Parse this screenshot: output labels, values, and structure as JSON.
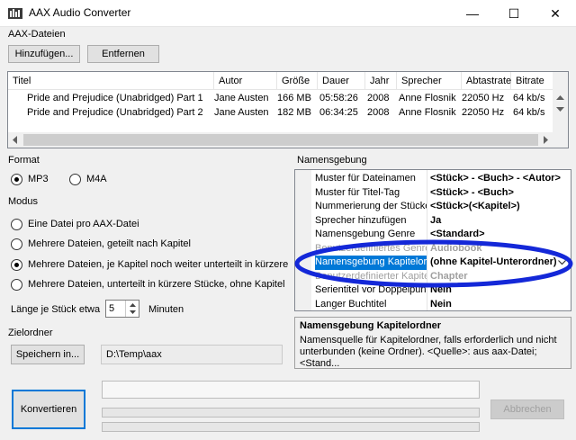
{
  "window": {
    "title": "AAX Audio Converter",
    "minimize": "—",
    "maximize": "☐",
    "close": "✕"
  },
  "aax": {
    "label": "AAX-Dateien",
    "add": "Hinzufügen...",
    "remove": "Entfernen",
    "columns": [
      "Titel",
      "Autor",
      "Größe",
      "Dauer",
      "Jahr",
      "Sprecher",
      "Abtastrate",
      "Bitrate"
    ],
    "rows": [
      [
        "Pride and Prejudice (Unabridged) Part 1",
        "Jane Austen",
        "166 MB",
        "05:58:26",
        "2008",
        "Anne Flosnik",
        "22050 Hz",
        "64 kb/s"
      ],
      [
        "Pride and Prejudice (Unabridged) Part 2",
        "Jane Austen",
        "182 MB",
        "06:34:25",
        "2008",
        "Anne Flosnik",
        "22050 Hz",
        "64 kb/s"
      ]
    ]
  },
  "format": {
    "label": "Format",
    "mp3": "MP3",
    "m4a": "M4A",
    "selected": "MP3"
  },
  "modus": {
    "label": "Modus",
    "options": [
      "Eine Datei pro AAX-Datei",
      "Mehrere Dateien, geteilt nach Kapitel",
      "Mehrere Dateien, je Kapitel noch weiter unterteilt in kürzere Stü",
      "Mehrere Dateien, unterteilt in kürzere Stücke, ohne Kapitel"
    ],
    "selected_index": 2,
    "length_label": "Länge je Stück etwa",
    "length_value": "5",
    "length_unit": "Minuten"
  },
  "zielordner": {
    "label": "Zielordner",
    "button": "Speichern in...",
    "path": "D:\\Temp\\aax"
  },
  "namensgebung": {
    "label": "Namensgebung",
    "properties": [
      {
        "name": "Muster für Dateinamen",
        "value": "<Stück> - <Buch> - <Autor>",
        "disabled": false
      },
      {
        "name": "Muster für Titel-Tag",
        "value": "<Stück> - <Buch>",
        "disabled": false
      },
      {
        "name": "Nummerierung der Stücke",
        "value": "<Stück>(<Kapitel>)",
        "disabled": false
      },
      {
        "name": "Sprecher hinzufügen",
        "value": "Ja",
        "disabled": false
      },
      {
        "name": "Namensgebung Genre",
        "value": "<Standard>",
        "disabled": false
      },
      {
        "name": "Benutzerdefiniertes Genre",
        "value": "Audiobook",
        "disabled": true
      },
      {
        "name": "Namensgebung Kapitelord",
        "value": "(ohne Kapitel-Unterordner)",
        "disabled": false,
        "selected": true
      },
      {
        "name": "Benutzerdefinierter Kapitel",
        "value": "Chapter",
        "disabled": true
      },
      {
        "name": "Serientitel vor Doppelpunk",
        "value": "Nein",
        "disabled": false
      },
      {
        "name": "Langer Buchtitel",
        "value": "Nein",
        "disabled": false
      }
    ],
    "help_title": "Namensgebung Kapitelordner",
    "help_text": "Namensquelle für Kapitelordner, falls erforderlich und nicht unterbunden (keine Ordner). <Quelle>: aus aax-Datei; <Stand..."
  },
  "actions": {
    "convert": "Konvertieren",
    "cancel": "Abbrechen"
  },
  "colors": {
    "selection": "#0078d7",
    "annotation": "#1428d8",
    "accent_border": "#0078d7"
  }
}
